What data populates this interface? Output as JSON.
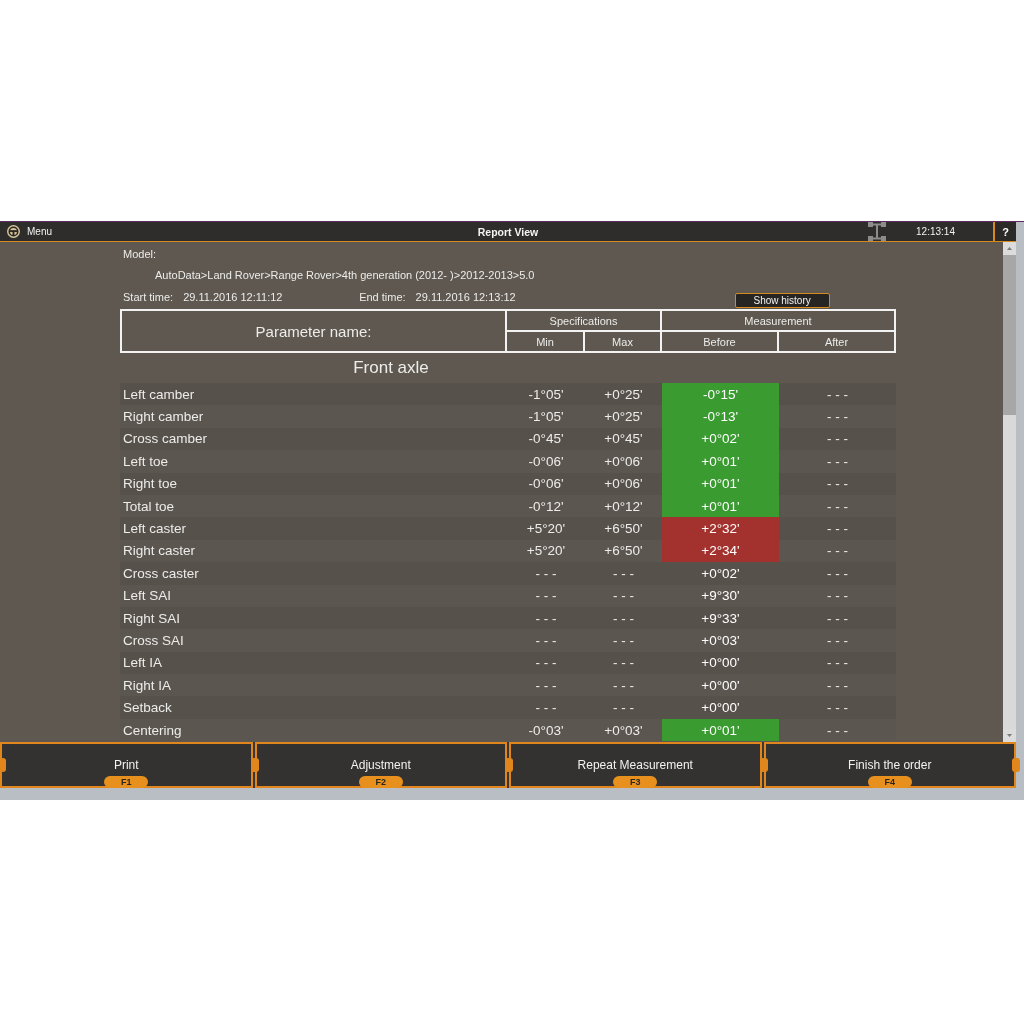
{
  "title_bar": {
    "menu": "Menu",
    "title": "Report View",
    "time": "12:13:14",
    "help": "?"
  },
  "report": {
    "model_label": "Model:",
    "model_path": "AutoData>Land Rover>Range Rover>4th generation (2012- )>2012-2013>5.0",
    "start_label": "Start time:",
    "start_time": "29.11.2016 12:11:12",
    "end_label": "End time:",
    "end_time": "29.11.2016 12:13:12",
    "show_history": "Show history"
  },
  "table": {
    "columns": {
      "parameter": "Parameter name:",
      "specifications": "Specifications",
      "min": "Min",
      "max": "Max",
      "measurement": "Measurement",
      "before": "Before",
      "after": "After"
    },
    "section": "Front axle",
    "rows": [
      {
        "name": "Left camber",
        "min": "-1°05'",
        "max": "+0°25'",
        "before": {
          "value": "-0°15'",
          "color": "#3a9b30"
        },
        "after": "- - -"
      },
      {
        "name": "Right camber",
        "min": "-1°05'",
        "max": "+0°25'",
        "before": {
          "value": "-0°13'",
          "color": "#3a9b30"
        },
        "after": "- - -"
      },
      {
        "name": "Cross camber",
        "min": "-0°45'",
        "max": "+0°45'",
        "before": {
          "value": "+0°02'",
          "color": "#3a9b30"
        },
        "after": "- - -"
      },
      {
        "name": "Left toe",
        "min": "-0°06'",
        "max": "+0°06'",
        "before": {
          "value": "+0°01'",
          "color": "#3a9b30"
        },
        "after": "- - -"
      },
      {
        "name": "Right toe",
        "min": "-0°06'",
        "max": "+0°06'",
        "before": {
          "value": "+0°01'",
          "color": "#3a9b30"
        },
        "after": "- - -"
      },
      {
        "name": "Total toe",
        "min": "-0°12'",
        "max": "+0°12'",
        "before": {
          "value": "+0°01'",
          "color": "#3a9b30"
        },
        "after": "- - -"
      },
      {
        "name": "Left caster",
        "min": "+5°20'",
        "max": "+6°50'",
        "before": {
          "value": "+2°32'",
          "color": "#a3322e"
        },
        "after": "- - -"
      },
      {
        "name": "Right caster",
        "min": "+5°20'",
        "max": "+6°50'",
        "before": {
          "value": "+2°34'",
          "color": "#a3322e"
        },
        "after": "- - -"
      },
      {
        "name": "Cross caster",
        "min": "- - -",
        "max": "- - -",
        "before": {
          "value": "+0°02'"
        },
        "after": "- - -"
      },
      {
        "name": "Left SAI",
        "min": "- - -",
        "max": "- - -",
        "before": {
          "value": "+9°30'"
        },
        "after": "- - -"
      },
      {
        "name": "Right SAI",
        "min": "- - -",
        "max": "- - -",
        "before": {
          "value": "+9°33'"
        },
        "after": "- - -"
      },
      {
        "name": "Cross SAI",
        "min": "- - -",
        "max": "- - -",
        "before": {
          "value": "+0°03'"
        },
        "after": "- - -"
      },
      {
        "name": "Left IA",
        "min": "- - -",
        "max": "- - -",
        "before": {
          "value": "+0°00'"
        },
        "after": "- - -"
      },
      {
        "name": "Right IA",
        "min": "- - -",
        "max": "- - -",
        "before": {
          "value": "+0°00'"
        },
        "after": "- - -"
      },
      {
        "name": "Setback",
        "min": "- - -",
        "max": "- - -",
        "before": {
          "value": "+0°00'"
        },
        "after": "- - -"
      },
      {
        "name": "Centering",
        "min": "-0°03'",
        "max": "+0°03'",
        "before": {
          "value": "+0°01'",
          "color": "#3a9b30"
        },
        "after": "- - -"
      }
    ]
  },
  "buttons": [
    {
      "label": "Print",
      "key": "F1"
    },
    {
      "label": "Adjustment",
      "key": "F2"
    },
    {
      "label": "Repeat Measurement",
      "key": "F3"
    },
    {
      "label": "Finish the order",
      "key": "F4"
    }
  ]
}
